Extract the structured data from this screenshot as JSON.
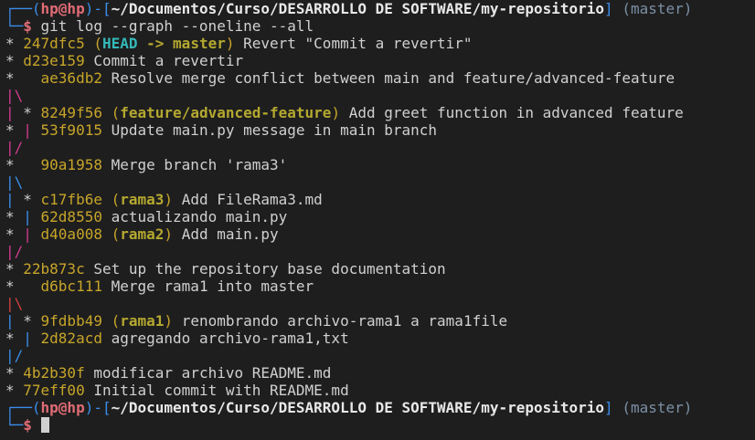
{
  "colors": {
    "graph": {
      "default": "#cfcfcf",
      "magenta": "#d13c8f",
      "cyan": "#3b8eea",
      "red": "#d14040"
    },
    "hash": "#c7a52a",
    "branch_ref": "#b4a830",
    "head_ref": "#35b9b9"
  },
  "prompt": {
    "user": "hp@hp",
    "path": "~/Documentos/Curso/DESARROLLO DE SOFTWARE/my-repositorio",
    "branch": "(master)",
    "command": "git log --graph --oneline --all"
  },
  "log": [
    {
      "graph": "* ",
      "hash": "247dfc5",
      "refs": "HEAD -> master",
      "message": "Revert \"Commit a revertir\""
    },
    {
      "graph": "* ",
      "hash": "d23e159",
      "refs": "",
      "message": "Commit a revertir"
    },
    {
      "graph": "*   ",
      "hash": "ae36db2",
      "refs": "",
      "message": "Resolve merge conflict between main and feature/advanced-feature"
    },
    {
      "graph": "|\\",
      "graph_color": "magenta"
    },
    {
      "graph": "| * ",
      "hash": "8249f56",
      "refs": "feature/advanced-feature",
      "message": "Add greet function in advanced feature",
      "graph_color": "magenta"
    },
    {
      "graph": "* | ",
      "hash": "53f9015",
      "refs": "",
      "message": "Update main.py message in main branch",
      "graph_color": "magenta"
    },
    {
      "graph": "|/",
      "graph_color": "magenta"
    },
    {
      "graph": "*   ",
      "hash": "90a1958",
      "refs": "",
      "message": "Merge branch 'rama3'"
    },
    {
      "graph": "|\\",
      "graph_color": "cyan"
    },
    {
      "graph": "| * ",
      "hash": "c17fb6e",
      "refs": "rama3",
      "message": "Add FileRama3.md",
      "graph_color": "cyan"
    },
    {
      "graph": "* | ",
      "hash": "62d8550",
      "refs": "",
      "message": "actualizando main.py",
      "graph_color": "cyan"
    },
    {
      "graph": "* | ",
      "hash": "d40a008",
      "refs": "rama2",
      "message": "Add main.py",
      "graph_color": "magenta"
    },
    {
      "graph": "|/",
      "graph_color": "magenta"
    },
    {
      "graph": "* ",
      "hash": "22b873c",
      "refs": "",
      "message": "Set up the repository base documentation"
    },
    {
      "graph": "*   ",
      "hash": "d6bc111",
      "refs": "",
      "message": "Merge rama1 into master"
    },
    {
      "graph": "|\\",
      "graph_color": "red"
    },
    {
      "graph": "| * ",
      "hash": "9fdbb49",
      "refs": "rama1",
      "message": "renombrando archivo-rama1 a rama1file",
      "graph_color": "cyan"
    },
    {
      "graph": "* | ",
      "hash": "2d82acd",
      "refs": "",
      "message": "agregando archivo-rama1,txt",
      "graph_color": "cyan"
    },
    {
      "graph": "|/",
      "graph_color": "cyan"
    },
    {
      "graph": "* ",
      "hash": "4b2b30f",
      "refs": "",
      "message": "modificar archivo README.md"
    },
    {
      "graph": "* ",
      "hash": "77eff00",
      "refs": "",
      "message": "Initial commit with README.md"
    }
  ],
  "prompt2": {
    "user": "hp@hp",
    "path": "~/Documentos/Curso/DESARROLLO DE SOFTWARE/my-repositorio",
    "branch": "(master)"
  }
}
